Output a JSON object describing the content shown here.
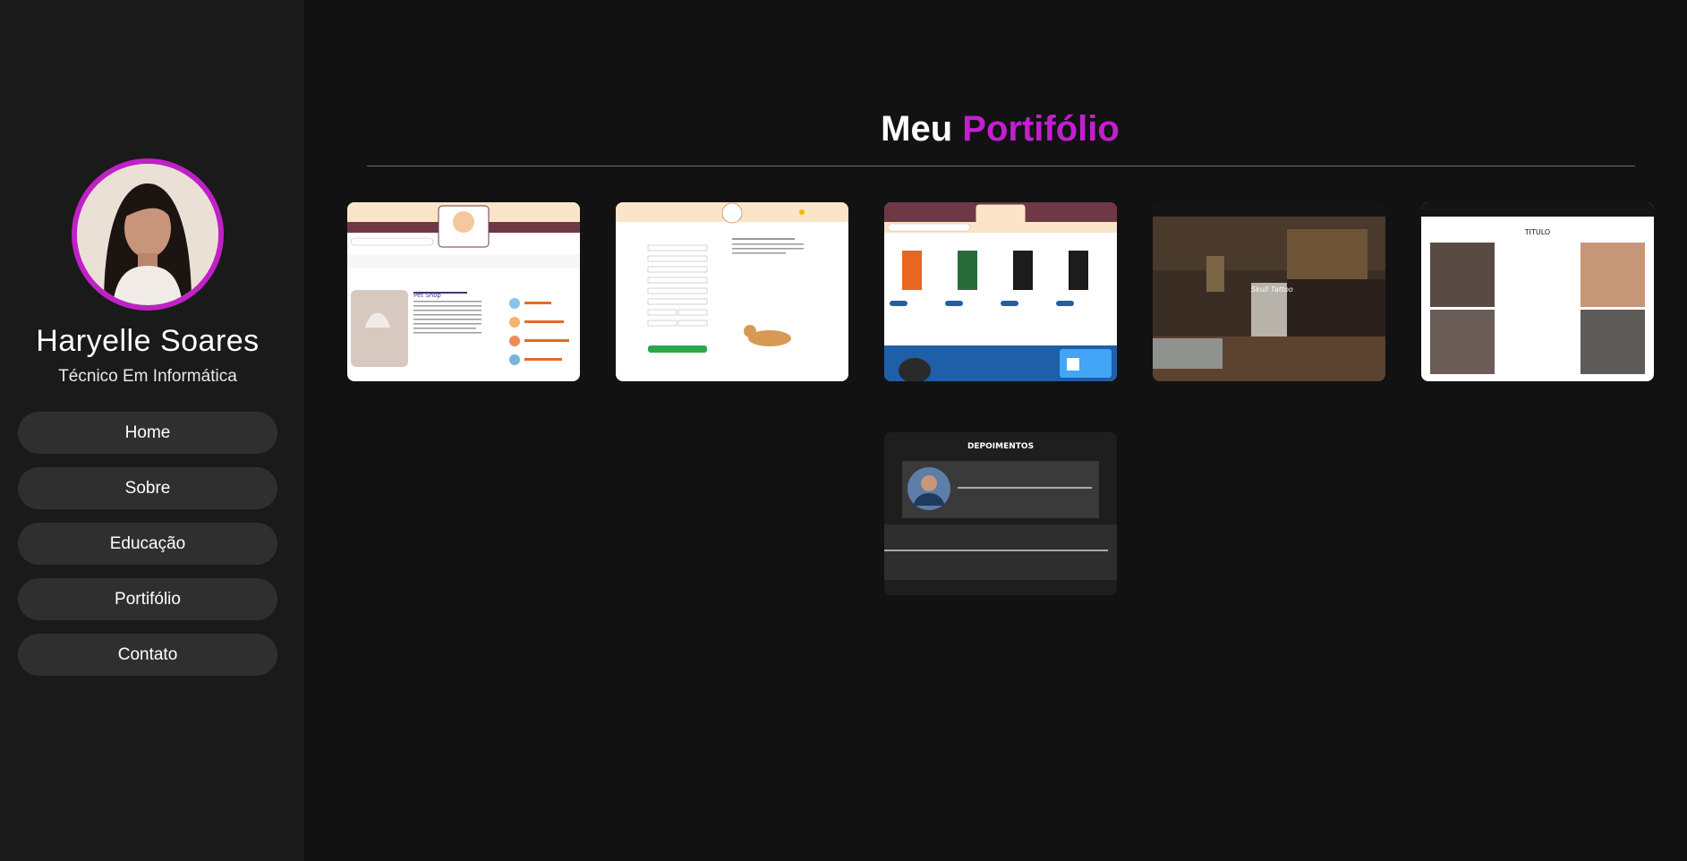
{
  "profile": {
    "name": "Haryelle Soares",
    "role": "Técnico Em Informática",
    "avatar_icon": "profile-photo"
  },
  "nav": {
    "items": [
      {
        "label": "Home"
      },
      {
        "label": "Sobre"
      },
      {
        "label": "Educação"
      },
      {
        "label": "Portifólio"
      },
      {
        "label": "Contato"
      }
    ]
  },
  "portfolio": {
    "title_part1": "Meu",
    "title_part2": "Portifólio",
    "cards": [
      {
        "heading": "Pet Shop"
      },
      {
        "heading": ""
      },
      {
        "heading": ""
      },
      {
        "heading": "Skull Tattoo"
      },
      {
        "heading": "TITULO"
      },
      {
        "heading": "DEPOIMENTOS"
      }
    ]
  },
  "colors": {
    "accent": "#c21fcf",
    "sidebar_bg": "#1a1a1a",
    "main_bg": "#121212",
    "button_bg": "#2f2f2f"
  }
}
